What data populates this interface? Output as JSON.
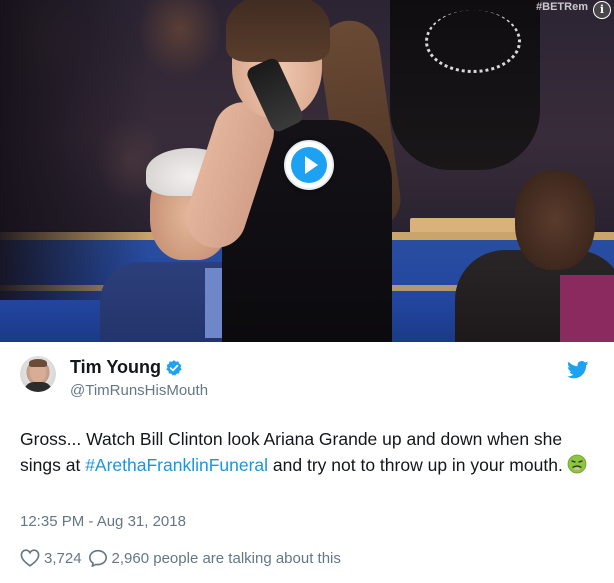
{
  "video": {
    "watermark": "#BETRem",
    "info_symbol": "i",
    "play_icon": "play-icon"
  },
  "tweet": {
    "display_name": "Tim Young",
    "handle": "@TimRunsHisMouth",
    "verified_icon": "verified-badge-icon",
    "brand_icon": "twitter-bird-icon",
    "text_before": "Gross... Watch Bill Clinton look Ariana Grande up and down when she sings at ",
    "hashtag": "#ArethaFranklinFuneral",
    "text_after": " and try not to throw up in your mouth.",
    "emoji": "nauseated-face-emoji",
    "timestamp": "12:35 PM - Aug 31, 2018",
    "likes": "3,724",
    "talking_text": "2,960 people are talking about this"
  },
  "colors": {
    "link": "#1b95e0",
    "brand_blue": "#1da1f2",
    "muted": "#657786",
    "text": "#14171a"
  }
}
